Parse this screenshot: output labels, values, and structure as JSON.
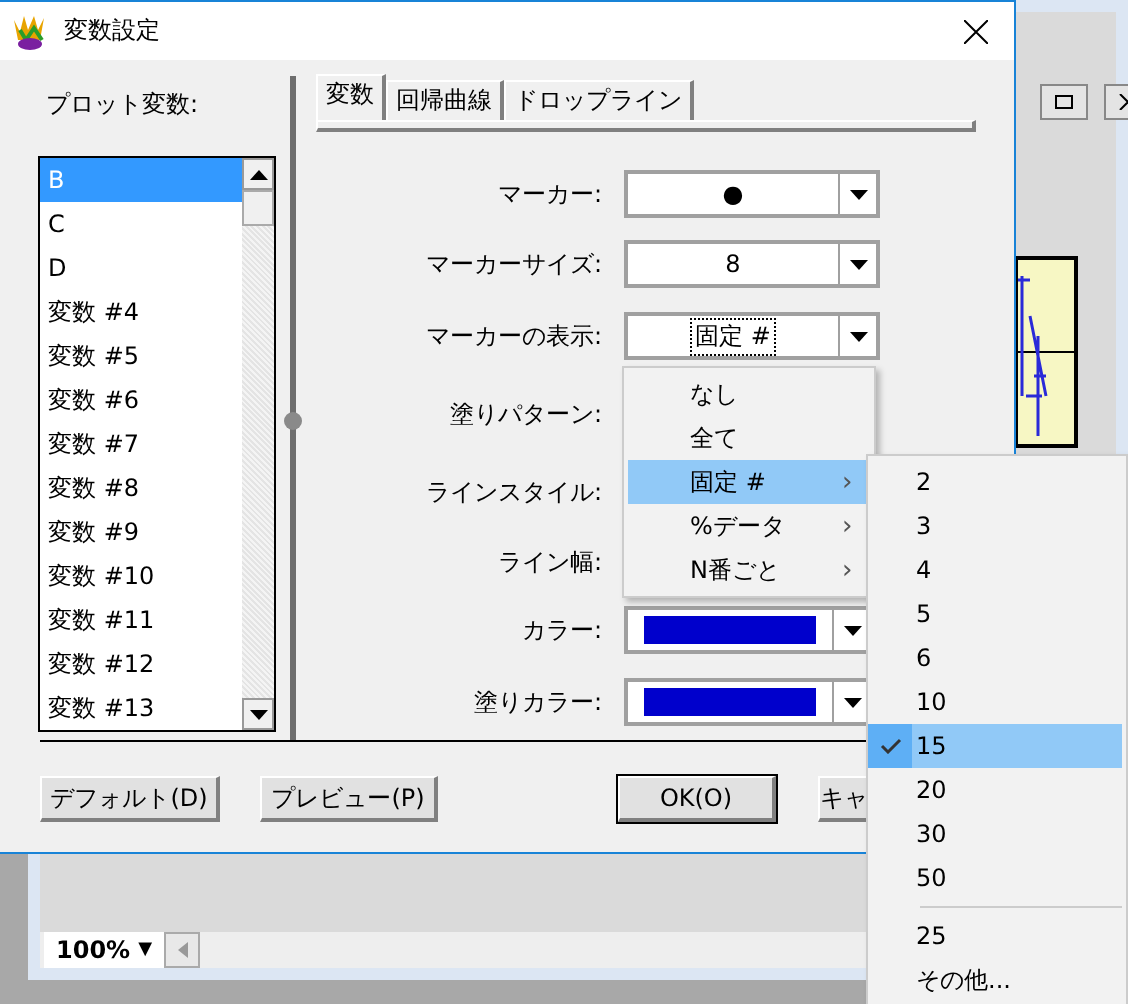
{
  "background_window": {
    "zoom": "100%",
    "zoom_caret": "▼"
  },
  "dialog": {
    "title": "変数設定",
    "plot_variables": {
      "label": "プロット変数:",
      "items": [
        {
          "label": "B",
          "selected": true
        },
        {
          "label": "C",
          "selected": false
        },
        {
          "label": "D",
          "selected": false
        },
        {
          "label": "変数 #4",
          "selected": false
        },
        {
          "label": "変数 #5",
          "selected": false
        },
        {
          "label": "変数 #6",
          "selected": false
        },
        {
          "label": "変数 #7",
          "selected": false
        },
        {
          "label": "変数 #8",
          "selected": false
        },
        {
          "label": "変数 #9",
          "selected": false
        },
        {
          "label": "変数 #10",
          "selected": false
        },
        {
          "label": "変数 #11",
          "selected": false
        },
        {
          "label": "変数 #12",
          "selected": false
        },
        {
          "label": "変数 #13",
          "selected": false
        }
      ]
    },
    "tabs": [
      {
        "label": "変数",
        "selected": true
      },
      {
        "label": "回帰曲線",
        "selected": false
      },
      {
        "label": "ドロップライン",
        "selected": false
      }
    ],
    "fields": [
      {
        "label": "マーカー:",
        "kind": "text",
        "value": "●",
        "focused": false
      },
      {
        "label": "マーカーサイズ:",
        "kind": "text",
        "value": "8",
        "focused": false
      },
      {
        "label": "マーカーの表示:",
        "kind": "text",
        "value": "固定 #",
        "focused": true
      },
      {
        "label": "塗りパターン:",
        "kind": "covered"
      },
      {
        "label": "ラインスタイル:",
        "kind": "covered"
      },
      {
        "label": "ライン幅:",
        "kind": "covered"
      },
      {
        "label": "カラー:",
        "kind": "color",
        "color": "#0000cc"
      },
      {
        "label": "塗りカラー:",
        "kind": "color",
        "color": "#0000cc"
      }
    ],
    "buttons": [
      "デフォルト(D)",
      "プレビュー(P)",
      "OK(O)",
      "キャ"
    ]
  },
  "dropdown_menu": {
    "items": [
      {
        "label": "なし",
        "selected": false,
        "submenu": false
      },
      {
        "label": "全て",
        "selected": false,
        "submenu": false
      },
      {
        "label": "固定 #",
        "selected": true,
        "submenu": true
      },
      {
        "label": "%データ",
        "selected": false,
        "submenu": true
      },
      {
        "label": "N番ごと",
        "selected": false,
        "submenu": true
      }
    ],
    "submenu_arrow": "›"
  },
  "submenu": {
    "sections": [
      [
        {
          "label": "2",
          "checked": false,
          "selected": false
        },
        {
          "label": "3",
          "checked": false,
          "selected": false
        },
        {
          "label": "4",
          "checked": false,
          "selected": false
        },
        {
          "label": "5",
          "checked": false,
          "selected": false
        },
        {
          "label": "6",
          "checked": false,
          "selected": false
        },
        {
          "label": "10",
          "checked": false,
          "selected": false
        },
        {
          "label": "15",
          "checked": true,
          "selected": true
        },
        {
          "label": "20",
          "checked": false,
          "selected": false
        },
        {
          "label": "30",
          "checked": false,
          "selected": false
        },
        {
          "label": "50",
          "checked": false,
          "selected": false
        }
      ],
      [
        {
          "label": "25",
          "checked": false,
          "selected": false
        },
        {
          "label": "その他...",
          "checked": false,
          "selected": false
        }
      ]
    ]
  }
}
